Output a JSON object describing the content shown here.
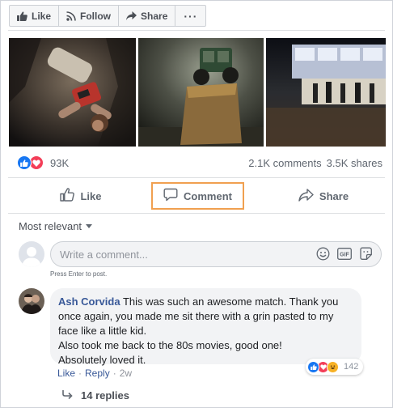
{
  "toolbar": {
    "like_label": "Like",
    "follow_label": "Follow",
    "share_label": "Share",
    "more_label": "···"
  },
  "photos": [
    {
      "icon": "photo-upside-down-player"
    },
    {
      "icon": "photo-tractor-in-fog"
    },
    {
      "icon": "photo-figures-at-night"
    }
  ],
  "summary": {
    "reaction_count": "93K",
    "comments": "2.1K comments",
    "shares": "3.5K shares"
  },
  "actions": {
    "like_label": "Like",
    "comment_label": "Comment",
    "share_label": "Share"
  },
  "sort": {
    "label": "Most relevant"
  },
  "compose": {
    "placeholder": "Write a comment...",
    "hint": "Press Enter to post."
  },
  "comment": {
    "author": "Ash Corvida",
    "text_line1": "This was such an awesome match. Thank you once again, you made me sit there with a grin pasted to my face like a little kid.",
    "text_line2": "Also took me back to the 80s movies, good one!",
    "text_line3": "Absolutely loved it.",
    "reaction_count": "142",
    "like_label": "Like",
    "reply_label": "Reply",
    "time": "2w",
    "separator": "·",
    "replies_label": "14 replies"
  },
  "colors": {
    "link": "#385898",
    "like_blue": "#1877f2",
    "love_red": "#f33e58",
    "highlight_orange": "#f0a050"
  }
}
